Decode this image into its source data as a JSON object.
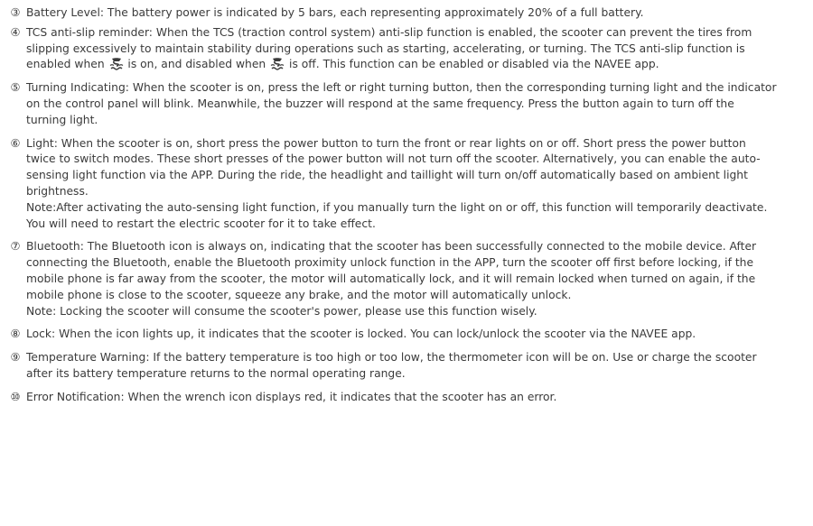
{
  "items": [
    {
      "num": "③",
      "text": "Battery Level: The battery power is indicated by 5 bars, each representing approximately 20% of a full battery."
    },
    {
      "num": "④",
      "text_a": "TCS anti-slip reminder: When the TCS (traction control system) anti-slip function is enabled, the scooter can prevent the tires from slipping excessively to maintain stability during operations such as starting, accelerating, or turning. The TCS anti-slip function is enabled when ",
      "text_b": " is on, and disabled when ",
      "text_c": " is off. This function can be enabled or disabled via the NAVEE app."
    },
    {
      "num": "⑤",
      "text": "Turning Indicating: When the scooter is on, press the left or right turning button, then the corresponding turning light and the indicator on the control panel will blink. Meanwhile, the buzzer will respond at the same frequency. Press the button again to turn off the turning light."
    },
    {
      "num": "⑥",
      "text": "Light: When the scooter is on, short press the power button to turn the front or rear lights on or off. Short press the power button twice to switch modes. These short presses of the power button will not turn off the scooter. Alternatively, you  can enable the auto-sensing light function via the APP. During the ride, the headlight and taillight will turn on/off automatically based on ambient light brightness.",
      "note": "Note:After activating the auto-sensing light function, if you manually turn the light on or off, this function will temporarily deactivate. You will need to restart the electric scooter for it to take effect."
    },
    {
      "num": "⑦",
      "text": "Bluetooth: The Bluetooth icon is always on, indicating that the scooter has been successfully connected to the mobile device. After connecting the Bluetooth, enable the Bluetooth proximity unlock function in the APP, turn the scooter off first before locking, if the mobile phone is far away from the scooter, the motor will automatically lock, and it will remain locked when turned on again, if the mobile phone is close to the scooter, squeeze any brake, and the motor will automatically unlock.",
      "note": "Note: Locking the scooter will consume the scooter's power, please use this function wisely."
    },
    {
      "num": "⑧",
      "text": "Lock: When the icon lights up, it indicates that the scooter is locked. You can lock/unlock the scooter via the NAVEE app."
    },
    {
      "num": "⑨",
      "text": "Temperature Warning: If the battery temperature is too high or too low, the thermometer icon will be on. Use or charge the scooter after its battery temperature returns to the normal operating range."
    },
    {
      "num": "⑩",
      "text": "Error Notification: When the wrench icon displays red, it indicates that the scooter has an error."
    }
  ]
}
